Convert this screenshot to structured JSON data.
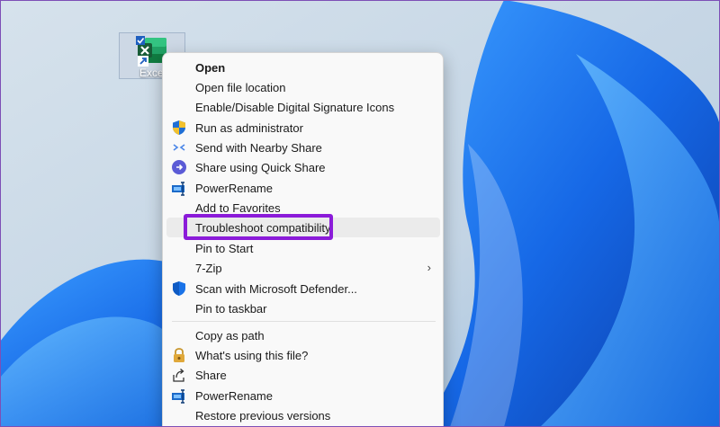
{
  "desktop": {
    "icon_label": "Excel",
    "icon_name": "excel-shortcut-icon"
  },
  "context_menu": {
    "items": [
      {
        "label": "Open",
        "bold": true,
        "icon": null
      },
      {
        "label": "Open file location",
        "icon": null
      },
      {
        "label": "Enable/Disable Digital Signature Icons",
        "icon": null
      },
      {
        "label": "Run as administrator",
        "icon": "uac-shield-icon"
      },
      {
        "label": "Send with Nearby Share",
        "icon": "nearby-share-icon"
      },
      {
        "label": "Share using Quick Share",
        "icon": "quick-share-icon"
      },
      {
        "label": "PowerRename",
        "icon": "powerrename-icon"
      },
      {
        "label": "Add to Favorites",
        "icon": null
      },
      {
        "label": "Troubleshoot compatibility",
        "icon": null,
        "hovered": true,
        "highlighted": true
      },
      {
        "label": "Pin to Start",
        "icon": null
      },
      {
        "label": "7-Zip",
        "icon": null,
        "submenu": true,
        "submenu_glyph": "›"
      },
      {
        "label": "Scan with Microsoft Defender...",
        "icon": "defender-shield-icon"
      },
      {
        "label": "Pin to taskbar",
        "icon": null
      },
      {
        "label": "Copy as path",
        "icon": null
      },
      {
        "label": "What's using this file?",
        "icon": "lock-icon"
      },
      {
        "label": "Share",
        "icon": "share-icon"
      },
      {
        "label": "PowerRename",
        "icon": "powerrename-icon"
      },
      {
        "label": "Restore previous versions",
        "icon": null
      }
    ]
  },
  "colors": {
    "highlight_border": "#8b1bd9",
    "menu_background": "#f9f9f9",
    "hover_background": "#ebebeb",
    "wallpaper_blue": "#1a6fe0"
  }
}
